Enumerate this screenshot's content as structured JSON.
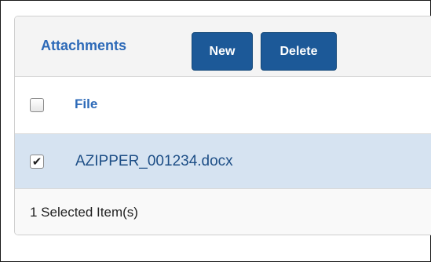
{
  "header": {
    "title": "Attachments",
    "new_label": "New",
    "delete_label": "Delete"
  },
  "table": {
    "columns": [
      "File"
    ],
    "rows": [
      {
        "file": "AZIPPER_001234.docx",
        "selected": true
      }
    ]
  },
  "footer": {
    "selected_count": 1,
    "selected_text": "1 Selected Item(s)"
  },
  "icons": {
    "header_checkbox": "checkbox-unchecked-icon",
    "row_checkbox": "checkbox-checked-icon"
  },
  "colors": {
    "accent": "#2d6ab8",
    "button_bg": "#1c5998",
    "selected_row_bg": "#d6e3f1"
  }
}
